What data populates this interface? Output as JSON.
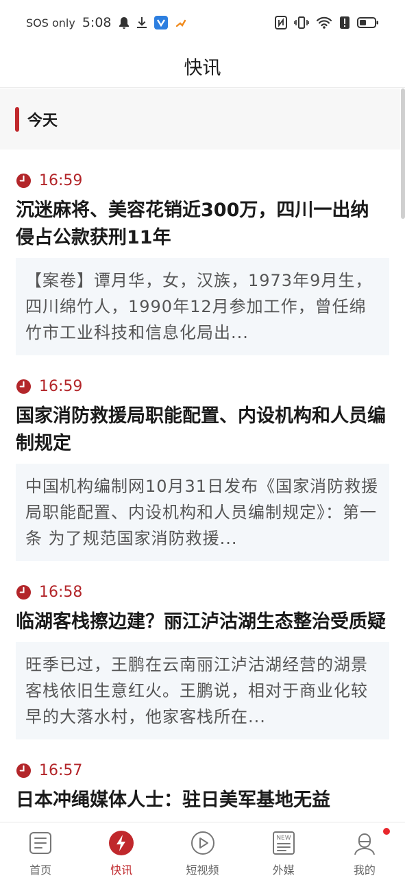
{
  "status_bar": {
    "carrier": "SOS only",
    "time": "5:08"
  },
  "header": {
    "title": "快讯"
  },
  "section": {
    "label": "今天"
  },
  "colors": {
    "accent": "#c0282c",
    "summary_bg": "#f4f7fa"
  },
  "news": [
    {
      "time": "16:59",
      "title": "沉迷麻将、美容花销近300万，四川一出纳侵占公款获刑11年",
      "summary": "【案卷】谭月华，女，汉族，1973年9月生，四川绵竹人，1990年12月参加工作，曾任绵竹市工业科技和信息化局出..."
    },
    {
      "time": "16:59",
      "title": "国家消防救援局职能配置、内设机构和人员编制规定",
      "summary": "中国机构编制网10月31日发布《国家消防救援局职能配置、内设机构和人员编制规定》：第一条 为了规范国家消防救援..."
    },
    {
      "time": "16:58",
      "title": "临湖客栈擦边建？丽江泸沽湖生态整治受质疑",
      "summary": "旺季已过，王鹏在云南丽江泸沽湖经营的湖景客栈依旧生意红火。王鹏说，相对于商业化较早的大落水村，他家客栈所在..."
    },
    {
      "time": "16:57",
      "title": "日本冲绳媒体人士：驻日美军基地无益",
      "summary": ""
    }
  ],
  "bottom_nav": [
    {
      "label": "首页",
      "icon": "home-doc-icon"
    },
    {
      "label": "快讯",
      "icon": "flash-icon"
    },
    {
      "label": "短视频",
      "icon": "play-icon"
    },
    {
      "label": "外媒",
      "icon": "news-icon"
    },
    {
      "label": "我的",
      "icon": "user-icon"
    }
  ]
}
